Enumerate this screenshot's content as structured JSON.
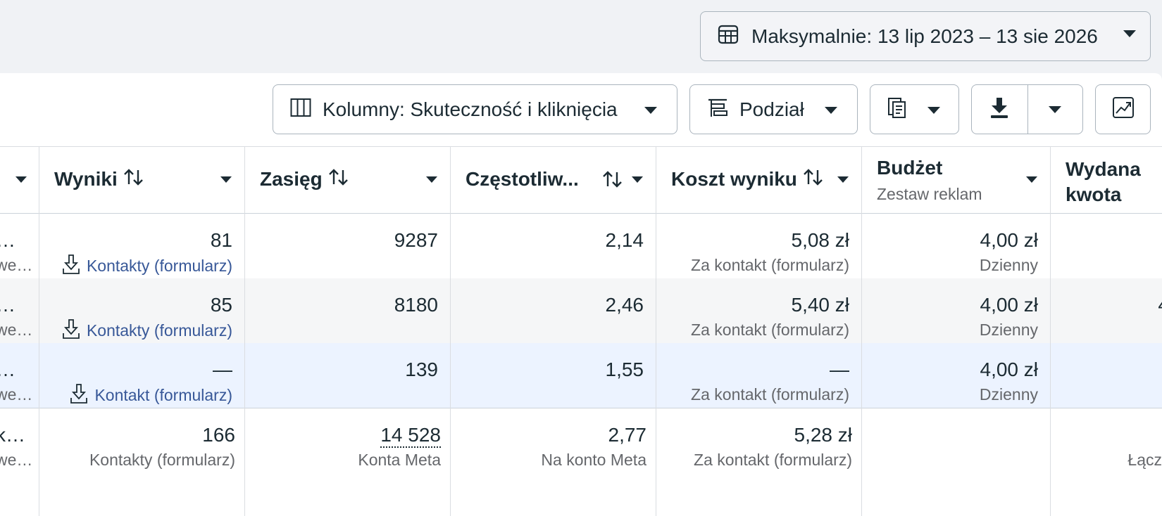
{
  "date_range": {
    "label": "Maksymalnie: 13 lip 2023 – 13 sie 2026",
    "icon": "table-calendar-icon"
  },
  "toolbar": {
    "columns_label": "Kolumny: Skuteczność i kliknięcia",
    "breakdown_label": "Podział",
    "reports_icon": "reports-icon",
    "export_icon": "download-icon",
    "chart_icon": "chart-icon"
  },
  "columns": [
    {
      "key": "wyniki",
      "title": "Wyniki",
      "sortable": true
    },
    {
      "key": "zasieg",
      "title": "Zasięg",
      "sortable": true
    },
    {
      "key": "czestotliwosc",
      "title": "Częstotliw...",
      "sortable": true
    },
    {
      "key": "koszt",
      "title": "Koszt wyniku",
      "sortable": true
    },
    {
      "key": "budzet",
      "title": "Budżet",
      "subtitle": "Zestaw reklam",
      "sortable": false
    },
    {
      "key": "wydana",
      "title": "Wydana kwota",
      "sortable": false
    }
  ],
  "rows": [
    {
      "name_trunc": "…",
      "name_sub_trunc": "we…",
      "wyniki": "81",
      "wyniki_type": "Kontakty (formularz)",
      "zasieg": "9287",
      "czestotliwosc": "2,14",
      "koszt": "5,08 zł",
      "koszt_sub": "Za kontakt (formularz)",
      "budzet": "4,00 zł",
      "budzet_sub": "Dzienny",
      "wydana": ""
    },
    {
      "name_trunc": "…",
      "name_sub_trunc": "we…",
      "wyniki": "85",
      "wyniki_type": "Kontakty (formularz)",
      "zasieg": "8180",
      "czestotliwosc": "2,46",
      "koszt": "5,40 zł",
      "koszt_sub": "Za kontakt (formularz)",
      "budzet": "4,00 zł",
      "budzet_sub": "Dzienny",
      "wydana": "4"
    },
    {
      "name_trunc": "…",
      "name_sub_trunc": "we…",
      "wyniki": "—",
      "wyniki_type": "Kontakt (formularz)",
      "zasieg": "139",
      "czestotliwosc": "1,55",
      "koszt": "—",
      "koszt_sub": "Za kontakt (formularz)",
      "budzet": "4,00 zł",
      "budzet_sub": "Dzienny",
      "wydana": ""
    }
  ],
  "totals": {
    "name_trunc": "k…",
    "name_sub_trunc": "we…",
    "wyniki": "166",
    "wyniki_sub": "Kontakty (formularz)",
    "zasieg": "14 528",
    "zasieg_sub": "Konta Meta",
    "czestotliwosc": "2,77",
    "czestotliwosc_sub": "Na konto Meta",
    "koszt": "5,28 zł",
    "koszt_sub": "Za kontakt (formularz)",
    "wydana_sub": "Łącz"
  },
  "colors": {
    "link": "#385898",
    "text": "#1c2b33",
    "muted": "#65676b",
    "selected_row": "#ecf3ff"
  }
}
